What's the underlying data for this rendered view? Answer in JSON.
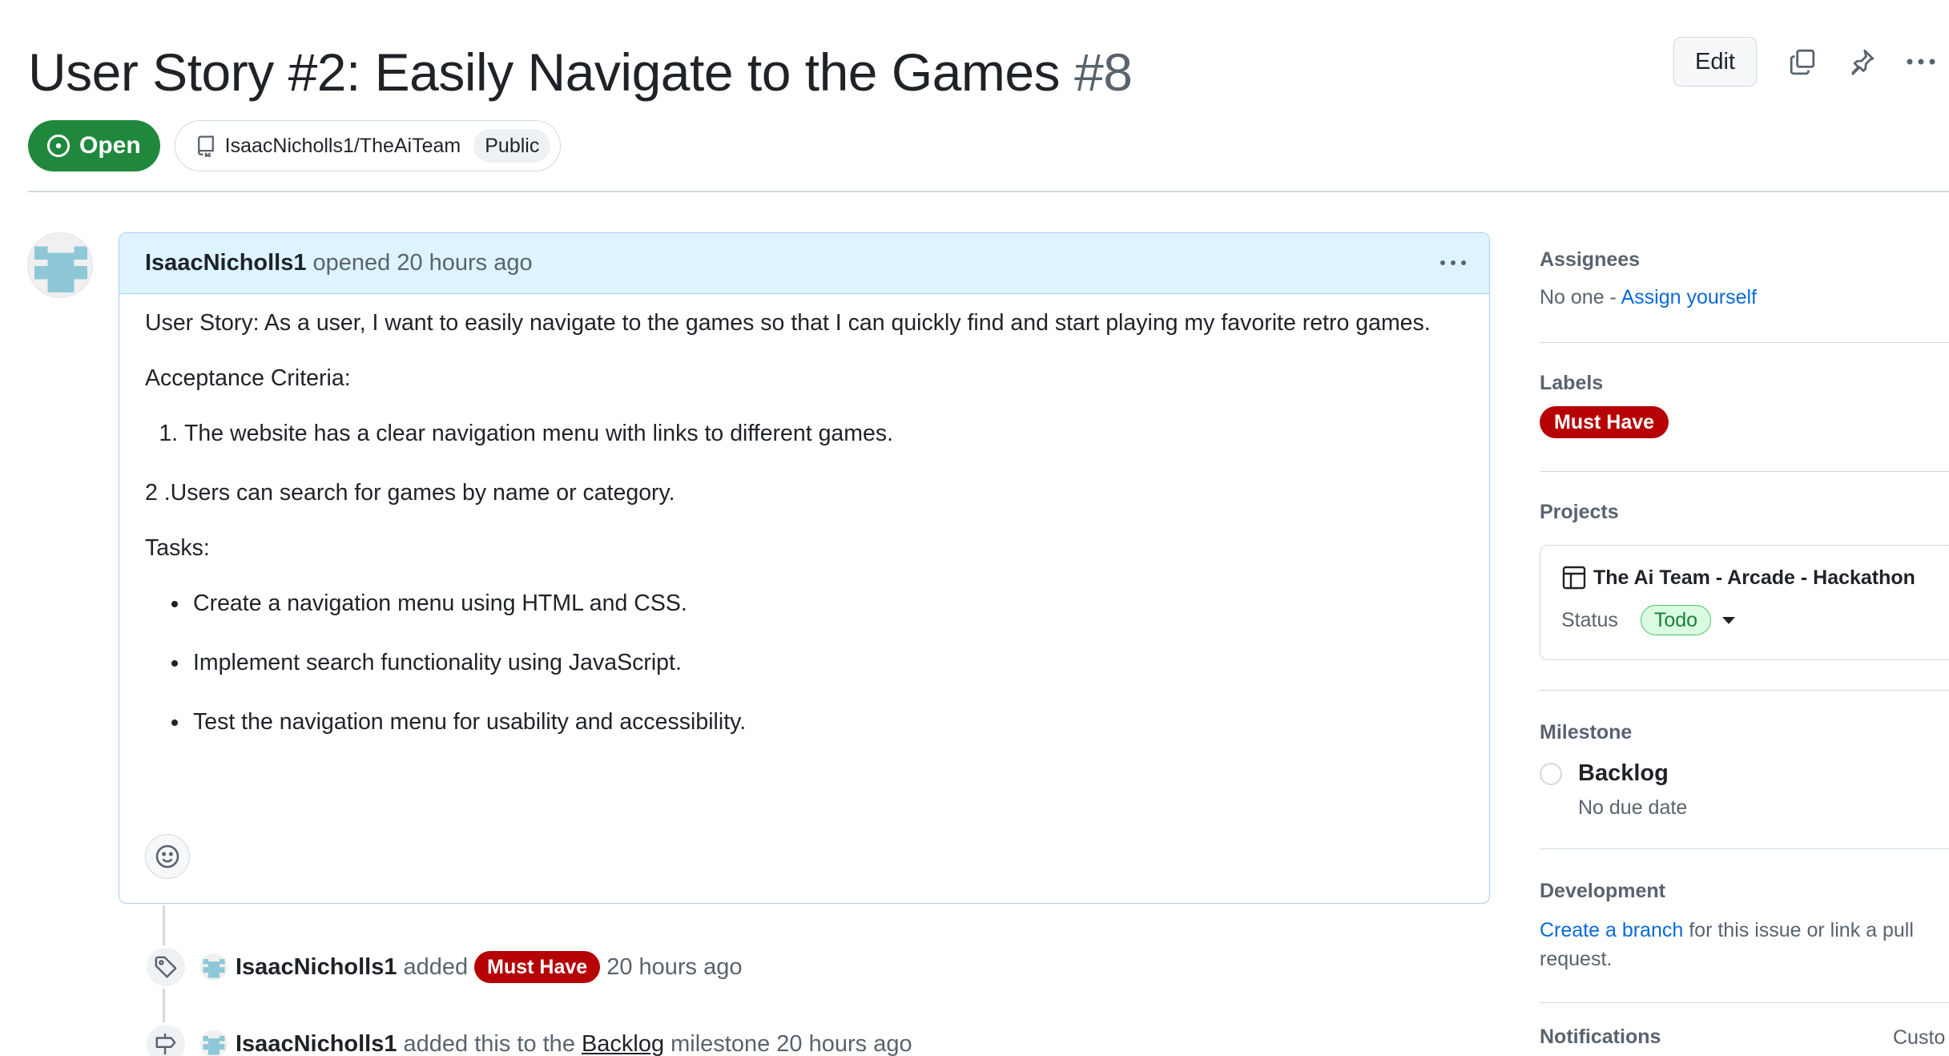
{
  "issue": {
    "title": "User Story #2: Easily Navigate to the Games",
    "number": "#8",
    "state": "Open",
    "repo": "IsaacNicholls1/TheAiTeam",
    "visibility": "Public"
  },
  "header_actions": {
    "edit_label": "Edit"
  },
  "comment": {
    "author": "IsaacNicholls1",
    "meta": "opened 20 hours ago",
    "story": "User Story: As a user, I want to easily navigate to the games so that I can quickly find and start playing my favorite retro games.",
    "acceptance_heading": "Acceptance Criteria:",
    "criteria_1": "The website has a clear navigation menu with links to different games.",
    "criteria_2": "2 .Users can search for games by name or category.",
    "tasks_heading": "Tasks:",
    "tasks": [
      "Create a navigation menu using HTML and CSS.",
      "Implement search functionality using JavaScript.",
      "Test the navigation menu for usability and accessibility."
    ]
  },
  "timeline": [
    {
      "author": "IsaacNicholls1",
      "action": "added",
      "label": "Must Have",
      "time": "20 hours ago"
    },
    {
      "author": "IsaacNicholls1",
      "action": "added this to the",
      "link": "Backlog",
      "suffix": "milestone 20 hours ago"
    }
  ],
  "sidebar": {
    "assignees": {
      "heading": "Assignees",
      "none_text": "No one -",
      "assign_link": "Assign yourself"
    },
    "labels": {
      "heading": "Labels",
      "items": [
        "Must Have"
      ]
    },
    "projects": {
      "heading": "Projects",
      "name": "The Ai Team - Arcade - Hackathon",
      "status_label": "Status",
      "status_value": "Todo"
    },
    "milestone": {
      "heading": "Milestone",
      "name": "Backlog",
      "due": "No due date"
    },
    "development": {
      "heading": "Development",
      "link": "Create a branch",
      "text": "for this issue or link a pull request."
    },
    "notifications": {
      "heading": "Notifications",
      "customize": "Custo"
    }
  },
  "colors": {
    "open_green": "#1f883d",
    "label_red": "#b60205",
    "link_blue": "#0969da",
    "comment_header_bg": "#ddf4ff"
  }
}
